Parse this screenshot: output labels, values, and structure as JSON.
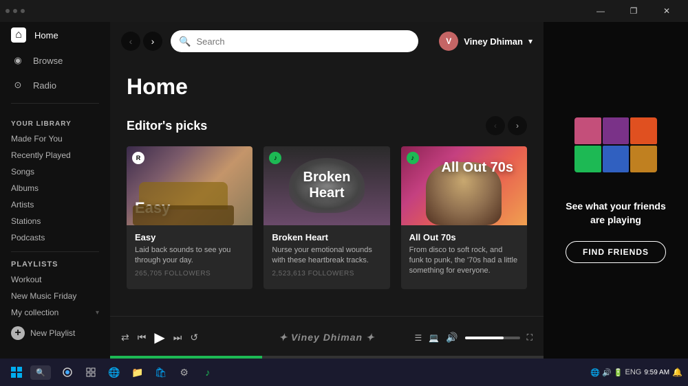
{
  "titlebar": {
    "dots_count": 3,
    "controls": {
      "minimize": "—",
      "restore": "❐",
      "close": "✕"
    }
  },
  "sidebar": {
    "nav_items": [
      {
        "id": "home",
        "label": "Home",
        "icon": "⌂",
        "active": true
      },
      {
        "id": "browse",
        "label": "Browse",
        "icon": "◉",
        "active": false
      },
      {
        "id": "radio",
        "label": "Radio",
        "icon": "📡",
        "active": false
      }
    ],
    "library_section": {
      "title": "YOUR LIBRARY",
      "items": [
        {
          "id": "made-for-you",
          "label": "Made For You"
        },
        {
          "id": "recently-played",
          "label": "Recently Played"
        },
        {
          "id": "songs",
          "label": "Songs"
        },
        {
          "id": "albums",
          "label": "Albums"
        },
        {
          "id": "artists",
          "label": "Artists"
        },
        {
          "id": "stations",
          "label": "Stations"
        },
        {
          "id": "podcasts",
          "label": "Podcasts"
        }
      ]
    },
    "playlists_section": {
      "title": "PLAYLISTS",
      "items": [
        {
          "id": "workout",
          "label": "Workout"
        },
        {
          "id": "new-music-friday",
          "label": "New Music Friday"
        },
        {
          "id": "my-collection",
          "label": "My collection"
        }
      ],
      "more_label": "..."
    },
    "new_playlist": "New Playlist"
  },
  "header": {
    "search_placeholder": "Search",
    "user_name": "Viney Dhiman",
    "user_initials": "V"
  },
  "main": {
    "page_title": "Home",
    "section_title": "Editor's picks",
    "cards": [
      {
        "id": "easy",
        "title": "Easy",
        "overlay_label": "Easy",
        "description": "Laid back sounds to see you through your day.",
        "followers": "265,705 FOLLOWERS",
        "badge_type": "letter",
        "badge_text": "R"
      },
      {
        "id": "broken-heart",
        "title": "Broken Heart",
        "overlay_label": "Broken Heart",
        "description": "Nurse your emotional wounds with these heartbreak tracks.",
        "followers": "2,523,613 FOLLOWERS",
        "badge_type": "spotify"
      },
      {
        "id": "all-out-70s",
        "title": "All Out 70s",
        "overlay_label": "All Out 70s",
        "description": "From disco to soft rock, and funk to punk, the '70s had a little something for everyone.",
        "followers": "",
        "badge_type": "spotify"
      }
    ]
  },
  "right_panel": {
    "title": "See what your friends are playing",
    "find_friends_label": "FIND FRIENDS",
    "art_colors": [
      "#c44f7a",
      "#7a3288",
      "#e05020",
      "#1DB954",
      "#3060c0",
      "#c08020"
    ]
  },
  "player": {
    "watermark": "Viney Dhiman",
    "volume_pct": 70,
    "progress_pct": 35
  },
  "taskbar": {
    "search_text": "",
    "time": "9:59 AM",
    "lang": "ENG"
  }
}
